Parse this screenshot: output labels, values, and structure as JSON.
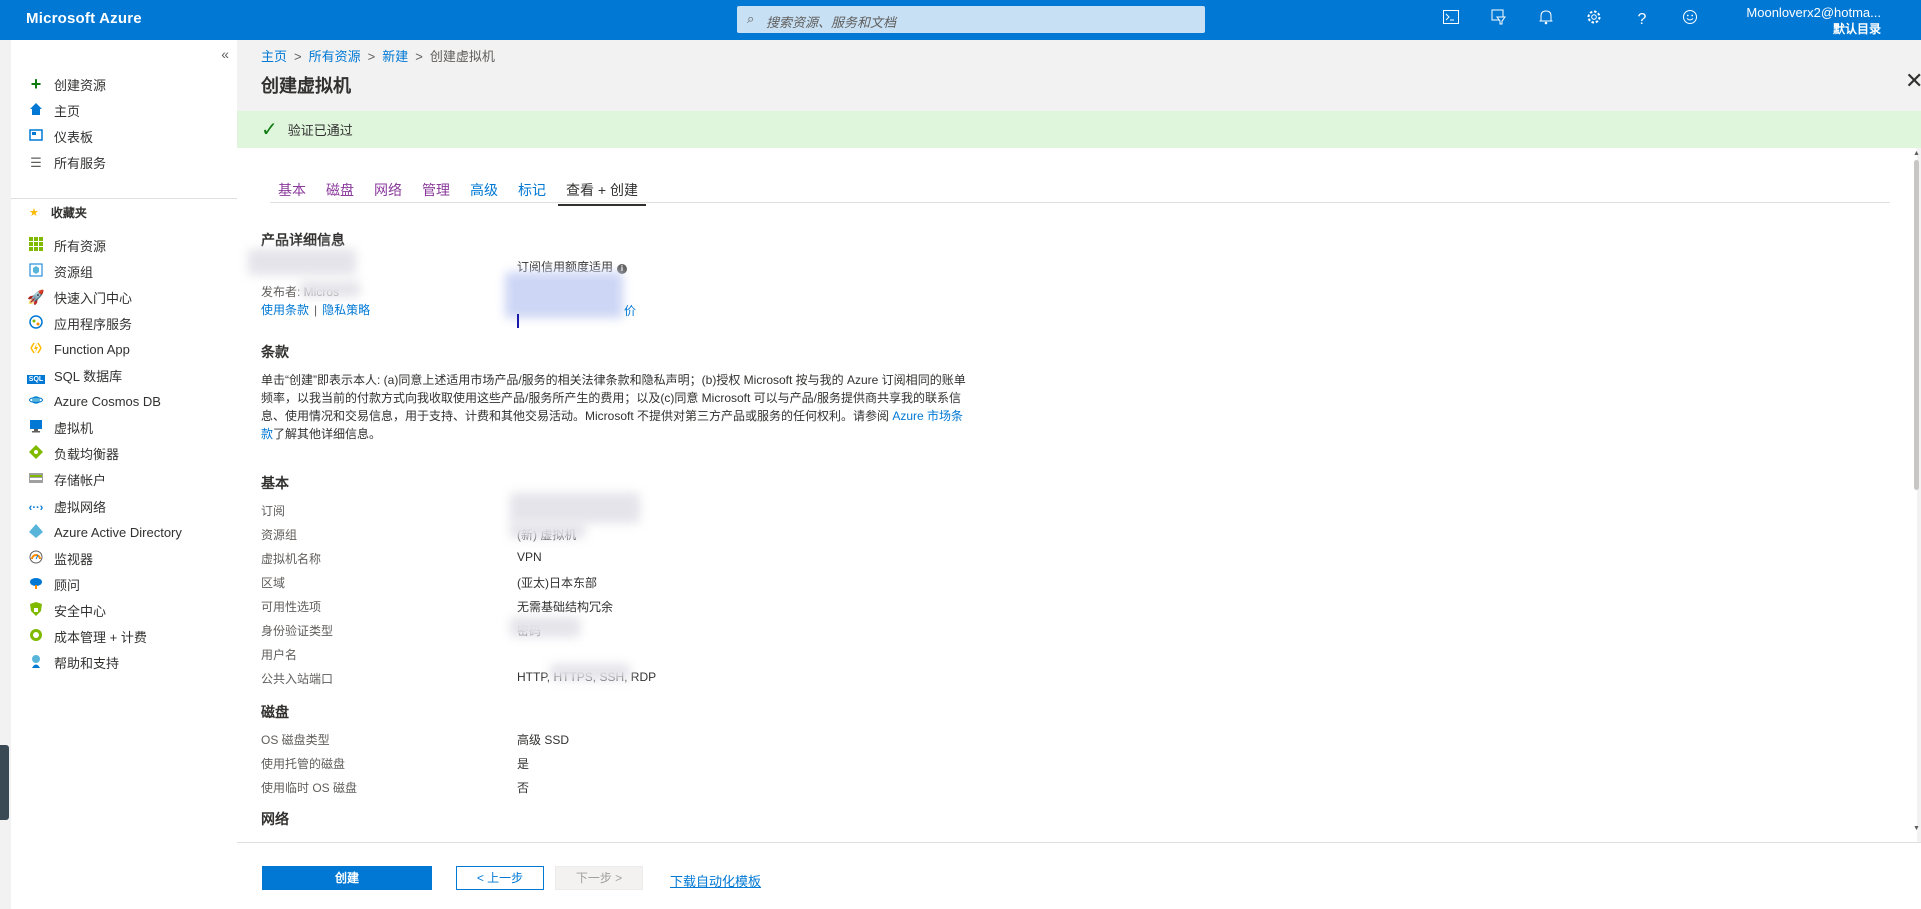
{
  "topbar": {
    "brand": "Microsoft Azure",
    "search_placeholder": "搜索资源、服务和文档",
    "icons": [
      "cloud-shell-icon",
      "directory-filter-icon",
      "notifications-bell-icon",
      "settings-gear-icon",
      "help-question-icon",
      "feedback-smiley-icon"
    ],
    "user_name": "Moonloverx2@hotma...",
    "user_directory": "默认目录"
  },
  "sidebar": {
    "collapse_glyph": "«",
    "items_top": [
      {
        "label": "创建资源",
        "icon": "plus-icon"
      },
      {
        "label": "主页",
        "icon": "home-icon"
      },
      {
        "label": "仪表板",
        "icon": "dashboard-icon"
      },
      {
        "label": "所有服务",
        "icon": "list-icon"
      }
    ],
    "favorites_label": "收藏夹",
    "items_fav": [
      {
        "label": "所有资源",
        "icon": "all-resources-icon"
      },
      {
        "label": "资源组",
        "icon": "resource-group-icon"
      },
      {
        "label": "快速入门中心",
        "icon": "rocket-icon"
      },
      {
        "label": "应用程序服务",
        "icon": "app-service-icon"
      },
      {
        "label": "Function App",
        "icon": "function-bolt-icon"
      },
      {
        "label": "SQL 数据库",
        "icon": "sql-database-icon"
      },
      {
        "label": "Azure Cosmos DB",
        "icon": "cosmos-db-icon"
      },
      {
        "label": "虚拟机",
        "icon": "virtual-machine-icon"
      },
      {
        "label": "负载均衡器",
        "icon": "load-balancer-icon"
      },
      {
        "label": "存储帐户",
        "icon": "storage-account-icon"
      },
      {
        "label": "虚拟网络",
        "icon": "virtual-network-icon"
      },
      {
        "label": "Azure Active Directory",
        "icon": "active-directory-icon"
      },
      {
        "label": "监视器",
        "icon": "monitor-gauge-icon"
      },
      {
        "label": "顾问",
        "icon": "advisor-cloud-icon"
      },
      {
        "label": "安全中心",
        "icon": "security-shield-icon"
      },
      {
        "label": "成本管理 + 计费",
        "icon": "cost-management-icon"
      },
      {
        "label": "帮助和支持",
        "icon": "help-support-icon"
      }
    ]
  },
  "breadcrumb": [
    "主页",
    "所有资源",
    "新建",
    "创建虚拟机"
  ],
  "page_title": "创建虚拟机",
  "validation_message": "验证已通过",
  "tabs": [
    "基本",
    "磁盘",
    "网络",
    "管理",
    "高级",
    "标记",
    "查看 + 创建"
  ],
  "product": {
    "heading": "产品详细信息",
    "publisher_label": "发布者: Micros",
    "terms_of_use": "使用条款",
    "separator": "|",
    "privacy_policy": "隐私策略",
    "credit_label": "订阅信用额度适用",
    "pricing_suffix": "价"
  },
  "terms": {
    "heading": "条款",
    "text": "单击“创建”即表示本人: (a)同意上述适用市场产品/服务的相关法律条款和隐私声明；(b)授权 Microsoft 按与我的 Azure 订阅相同的账单频率，以我当前的付款方式向我收取使用这些产品/服务所产生的费用；以及(c)同意 Microsoft 可以与产品/服务提供商共享我的联系信息、使用情况和交易信息，用于支持、计费和其他交易活动。Microsoft 不提供对第三方产品或服务的任何权利。请参阅 ",
    "link": "Azure 市场条款",
    "tail": "了解其他详细信息。"
  },
  "basics": {
    "heading": "基本",
    "rows": [
      {
        "label": "订阅",
        "value": ""
      },
      {
        "label": "资源组",
        "value": "(新) 虚拟机"
      },
      {
        "label": "虚拟机名称",
        "value": "VPN"
      },
      {
        "label": "区域",
        "value": "(亚太)日本东部"
      },
      {
        "label": "可用性选项",
        "value": "无需基础结构冗余"
      },
      {
        "label": "身份验证类型",
        "value": "密码"
      },
      {
        "label": "用户名",
        "value": ""
      },
      {
        "label": "公共入站端口",
        "value": "HTTP, HTTPS, SSH, RDP"
      }
    ]
  },
  "disks": {
    "heading": "磁盘",
    "rows": [
      {
        "label": "OS 磁盘类型",
        "value": "高级 SSD"
      },
      {
        "label": "使用托管的磁盘",
        "value": "是"
      },
      {
        "label": "使用临时 OS 磁盘",
        "value": "否"
      }
    ]
  },
  "network": {
    "heading": "网络"
  },
  "footer": {
    "create": "创建",
    "prev": "< 上一步",
    "next": "下一步 >",
    "download": "下载自动化模板"
  },
  "colors": {
    "accent": "#0078d4",
    "success_bg": "#dff6dd",
    "success_check": "#107c10",
    "visited_tab": "#8a3a9b"
  }
}
